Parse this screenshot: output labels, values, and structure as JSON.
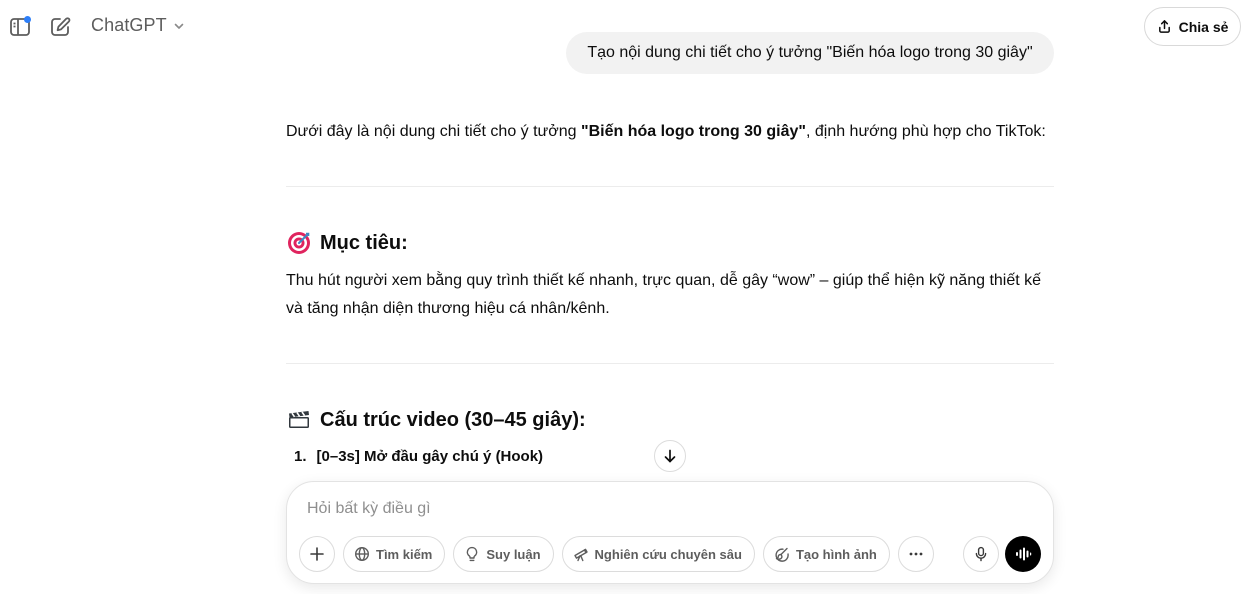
{
  "header": {
    "model_name": "ChatGPT",
    "share_label": "Chia sẻ",
    "sidebar_icon": "sidebar-toggle-icon",
    "new_chat_icon": "new-chat-icon",
    "accent_dot_color": "#2d7ff9"
  },
  "conversation": {
    "user_message": "Tạo nội dung chi tiết cho ý tưởng \"Biến hóa logo trong 30 giây\"",
    "intro_before": "Dưới đây là nội dung chi tiết cho ý tưởng ",
    "intro_bold": "\"Biến hóa logo trong 30 giây\"",
    "intro_after": ", định hướng phù hợp cho TikTok:",
    "section1_icon": "target-emoji-icon",
    "section1_title": "Mục tiêu:",
    "section1_line1": "Thu hút người xem bằng quy trình thiết kế nhanh, trực quan, dễ gây “wow” – giúp thể hiện kỹ năng thiết kế",
    "section1_line2": "và tăng nhận diện thương hiệu cá nhân/kênh.",
    "section2_icon": "clapperboard-emoji-icon",
    "section2_title": "Cấu trúc video (30–45 giây):",
    "list_number": "1.",
    "list_item": "[0–3s] Mở đầu gây chú ý (Hook)"
  },
  "composer": {
    "placeholder": "Hỏi bất kỳ điều gì",
    "tools": [
      {
        "label": "Tìm kiếm",
        "icon": "globe-icon"
      },
      {
        "label": "Suy luận",
        "icon": "lightbulb-icon"
      },
      {
        "label": "Nghiên cứu chuyên sâu",
        "icon": "telescope-icon"
      },
      {
        "label": "Tạo hình ảnh",
        "icon": "image-brush-icon"
      }
    ],
    "more_icon": "more-icon",
    "mic_icon": "microphone-icon",
    "voice_icon": "voice-mode-icon"
  }
}
